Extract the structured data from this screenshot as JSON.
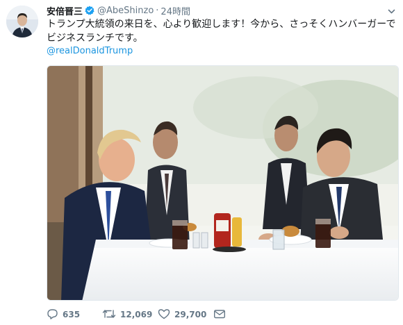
{
  "tweet": {
    "author": {
      "display_name": "安倍晋三",
      "handle": "@AbeShinzo",
      "separator": "·",
      "timestamp": "24時間"
    },
    "text_lines": [
      "トランプ大統領の来日を、心より歓迎します！今から、さっそくハンバーガーで",
      "ビジネスランチです。"
    ],
    "mention": "@realDonaldTrump",
    "actions": {
      "reply_count": "635",
      "retweet_count": "12,069",
      "like_count": "29,700"
    },
    "icons": {
      "verified": "verified-badge-icon",
      "menu": "chevron-down-icon",
      "reply": "reply-icon",
      "retweet": "retweet-icon",
      "like": "heart-icon",
      "dm": "envelope-icon"
    },
    "colors": {
      "link": "#1b95e0",
      "verified": "#1da1f2",
      "meta": "#657786",
      "text": "#14171a"
    }
  }
}
